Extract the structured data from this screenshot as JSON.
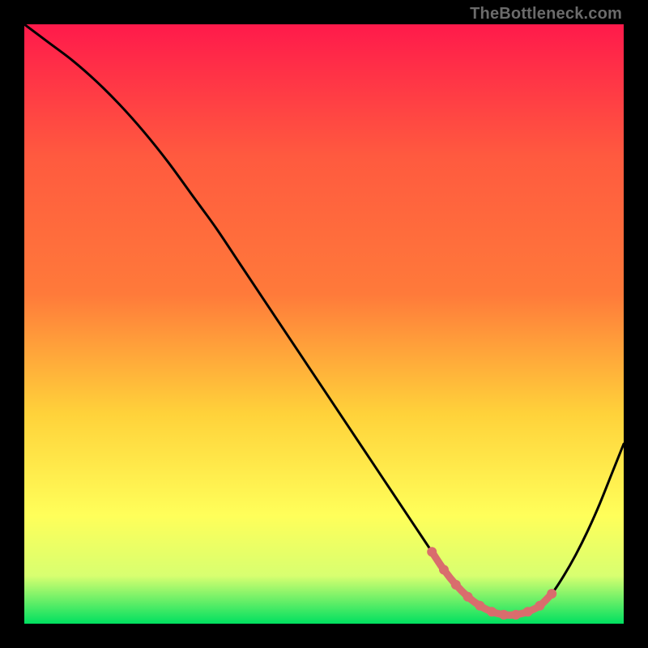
{
  "watermark": "TheBottleneck.com",
  "colors": {
    "background": "#000000",
    "gradient_top": "#ff1a4b",
    "gradient_mid1": "#ff7a3a",
    "gradient_mid2": "#ffd23a",
    "gradient_mid3": "#ffff5a",
    "gradient_mid4": "#d8ff70",
    "gradient_bottom": "#00e060",
    "curve": "#000000",
    "marker": "#d96d6d"
  },
  "chart_data": {
    "type": "line",
    "title": "",
    "xlabel": "",
    "ylabel": "",
    "xlim": [
      0,
      100
    ],
    "ylim": [
      0,
      100
    ],
    "grid": false,
    "legend": false,
    "series": [
      {
        "name": "bottleneck-curve",
        "x": [
          0,
          4,
          8,
          12,
          16,
          20,
          24,
          28,
          32,
          36,
          40,
          44,
          48,
          52,
          56,
          60,
          64,
          66,
          68,
          70,
          72,
          74,
          76,
          78,
          80,
          82,
          84,
          86,
          88,
          90,
          92,
          94,
          96,
          98,
          100
        ],
        "y": [
          100,
          97,
          94,
          90.5,
          86.5,
          82,
          77,
          71.5,
          66,
          60,
          54,
          48,
          42,
          36,
          30,
          24,
          18,
          15,
          12,
          9,
          6.5,
          4.5,
          3,
          2,
          1.5,
          1.5,
          2,
          3,
          5,
          8,
          11.5,
          15.5,
          20,
          25,
          30
        ]
      }
    ],
    "markers": {
      "name": "optimal-range",
      "x": [
        68,
        70,
        72,
        74,
        76,
        78,
        80,
        82,
        84,
        86,
        88
      ],
      "y": [
        12,
        9,
        6.5,
        4.5,
        3,
        2,
        1.5,
        1.5,
        2,
        3,
        5
      ]
    }
  }
}
